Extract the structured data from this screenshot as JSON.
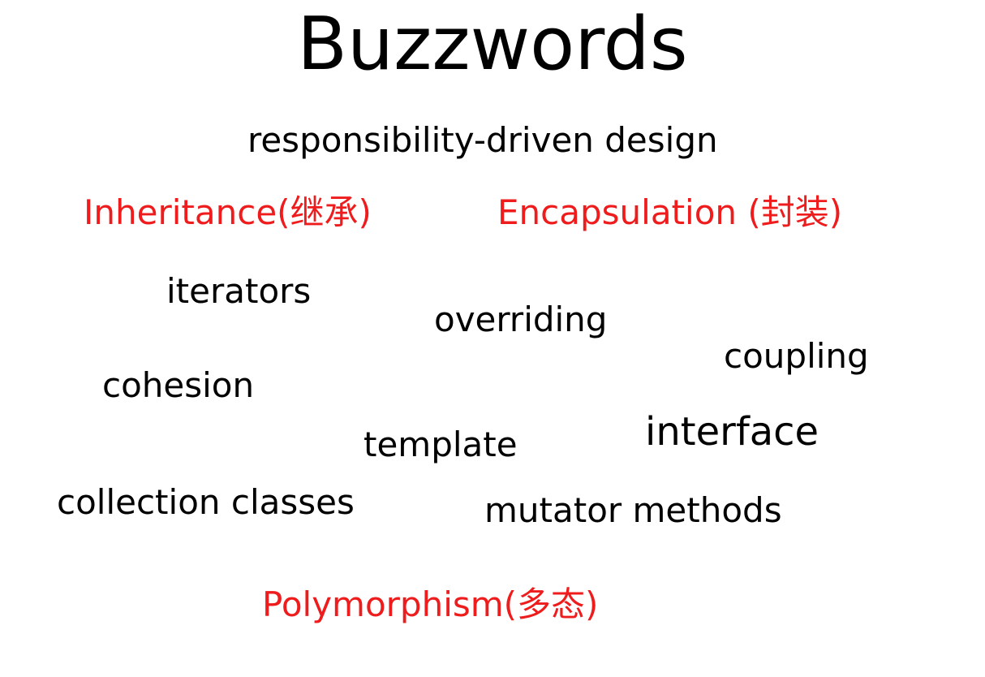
{
  "slide": {
    "title": "Buzzwords",
    "accent_color": "#ee1c1c",
    "text_color": "#000000",
    "terms": {
      "responsibility_driven_design": "responsibility-driven design",
      "inheritance": "Inheritance(继承)",
      "encapsulation": "Encapsulation (封装)",
      "iterators": "iterators",
      "overriding": "overriding",
      "coupling": "coupling",
      "cohesion": "cohesion",
      "interface": "interface",
      "template": "template",
      "collection_classes": "collection classes",
      "mutator_methods": "mutator methods",
      "polymorphism": "Polymorphism(多态)"
    }
  }
}
